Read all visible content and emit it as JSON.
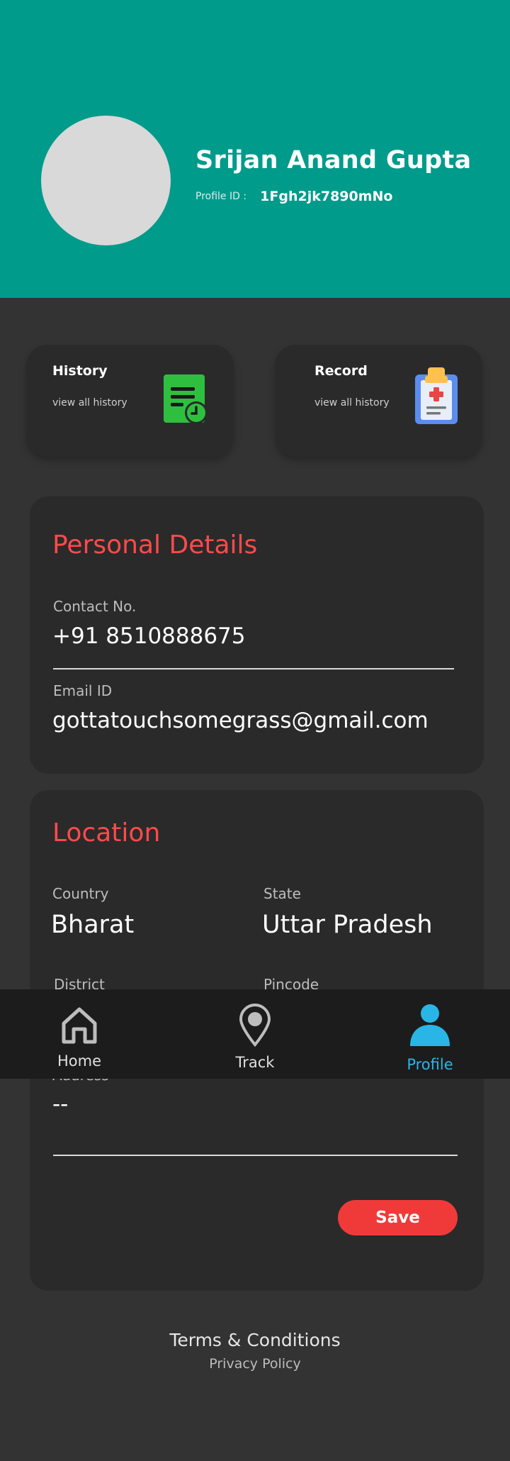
{
  "profile": {
    "name": "Srijan Anand Gupta",
    "id_label": "Profile ID :",
    "id_value": "1Fgh2jk7890mNo"
  },
  "cards": {
    "history": {
      "title": "History",
      "subtitle": "view all history",
      "icon": "history-document-icon"
    },
    "record": {
      "title": "Record",
      "subtitle": "view all history",
      "icon": "medical-clipboard-icon"
    }
  },
  "personal_details": {
    "title": "Personal Details",
    "contact_label": "Contact No.",
    "contact_value": "+91 8510888675",
    "email_label": "Email ID",
    "email_value": "gottatouchsomegrass@gmail.com"
  },
  "location": {
    "title": "Location",
    "country_label": "Country",
    "country_value": "Bharat",
    "state_label": "State",
    "state_value": "Uttar Pradesh",
    "district_label": "District",
    "pincode_label": "Pincode",
    "address_label": "Address",
    "address_value": "--"
  },
  "actions": {
    "save_label": "Save"
  },
  "nav": {
    "items": [
      {
        "label": "Home",
        "icon": "home-icon",
        "active": false
      },
      {
        "label": "Track",
        "icon": "location-pin-icon",
        "active": false
      },
      {
        "label": "Profile",
        "icon": "person-icon",
        "active": true
      }
    ]
  },
  "footer": {
    "terms": "Terms  & Conditions",
    "privacy": "Privacy Policy"
  },
  "colors": {
    "header_bg": "#009b8b",
    "accent_red": "#ff4a4a",
    "active_nav": "#29b6e6",
    "save_button": "#f03a3a",
    "history_icon": "#2fbf3f",
    "record_icon": "#5b8def"
  }
}
